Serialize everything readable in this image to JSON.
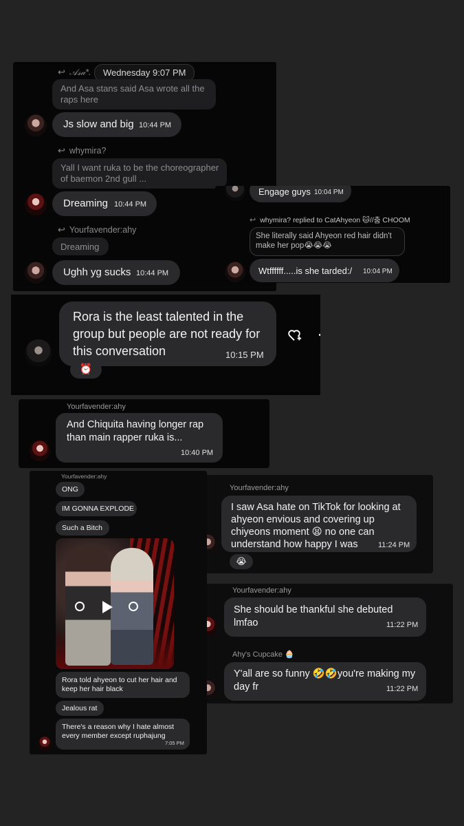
{
  "card1": {
    "quote1_author": "𝒜𝓈𝒶*.",
    "date_chip": "Wednesday 9:07 PM",
    "quote1_text": "And Asa stans said Asa wrote all the raps here",
    "msg1_text": "Js slow and big",
    "msg1_time": "10:44 PM",
    "quote2_author": "whymira?",
    "quote2_text": "Yall I want ruka to be the choreographer of baemon 2nd gull ...",
    "msg2_text": "Dreaming",
    "msg2_time": "10:44 PM",
    "quote3_author": "Yourfavender:ahy",
    "quote3_text": "Dreaming",
    "msg3_text": "Ughh yg sucks",
    "msg3_time": "10:44 PM"
  },
  "card2": {
    "msg1_text": "Engage guys",
    "msg1_time": "10:04 PM",
    "reply_header": "whymira? replied to CatAhyeon 🐱//춤 CHOOM",
    "quote_text": "She literally said Ahyeon red hair didn't make her pop😭😭😭",
    "msg2_text": "Wtffffff.....is she tarded:/",
    "msg2_time": "10:04 PM"
  },
  "card3": {
    "msg_text": "Rora is the least talented in the group but people are not ready for this conversation",
    "msg_time": "10:15 PM",
    "reaction": "⏰"
  },
  "card4": {
    "author": "Yourfavender:ahy",
    "msg_text": "And Chiquita having longer rap than main rapper ruka is...",
    "msg_time": "10:40 PM"
  },
  "card5": {
    "author": "Yourfavender:ahy",
    "msg1": "ONG",
    "msg2": "IM GONNA EXPLODE",
    "msg3": "Such a Bitch",
    "msg4": "Rora told ahyeon to cut her hair and keep her hair black",
    "msg5": "Jealous rat",
    "msg6": "There's a reason why I hate almost every member except ruphajung",
    "msg6_time": "7:05 PM"
  },
  "card6": {
    "author": "Yourfavender:ahy",
    "msg_text": "I saw Asa hate on TikTok for looking at ahyeon envious and covering up chiyeons moment 😫 no one can understand how happy I was",
    "msg_time": "11:24 PM",
    "reaction": "😭"
  },
  "card7": {
    "author1": "Yourfavender:ahy",
    "msg1_text": "She should be thankful she debuted lmfao",
    "msg1_time": "11:22 PM",
    "author2": "Ahy's Cupcake 🧁",
    "msg2_text": "Y'all are so funny 🤣🤣you're making my day fr",
    "msg2_time": "11:22 PM"
  },
  "colors": {
    "background": "#232323",
    "panel": "#060606",
    "bubble": "#2a2a2c"
  }
}
